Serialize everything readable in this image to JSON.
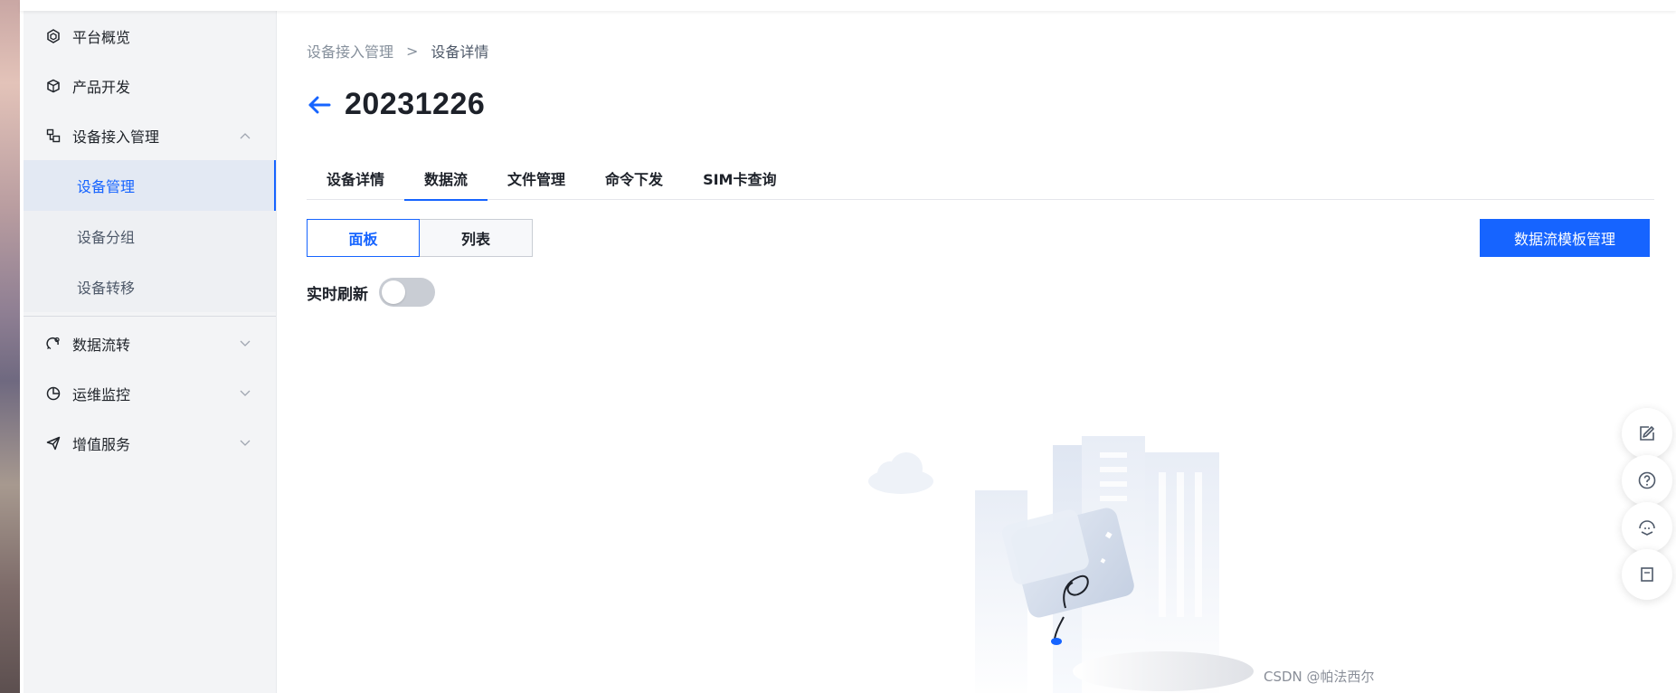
{
  "sidebar": {
    "items": [
      {
        "label": "平台概览",
        "icon": "overview-icon"
      },
      {
        "label": "产品开发",
        "icon": "cube-icon"
      },
      {
        "label": "设备接入管理",
        "icon": "device-access-icon",
        "expanded": true,
        "children": [
          {
            "label": "设备管理",
            "active": true
          },
          {
            "label": "设备分组"
          },
          {
            "label": "设备转移"
          }
        ]
      },
      {
        "label": "数据流转",
        "icon": "data-flow-icon"
      },
      {
        "label": "运维监控",
        "icon": "pie-chart-icon"
      },
      {
        "label": "增值服务",
        "icon": "send-icon"
      }
    ]
  },
  "breadcrumb": {
    "parent": "设备接入管理",
    "separator": ">",
    "current": "设备详情"
  },
  "page": {
    "title": "20231226"
  },
  "tabs": [
    {
      "label": "设备详情"
    },
    {
      "label": "数据流",
      "active": true
    },
    {
      "label": "文件管理"
    },
    {
      "label": "命令下发"
    },
    {
      "label": "SIM卡查询"
    }
  ],
  "view_toggle": {
    "panel": "面板",
    "list": "列表",
    "selected": "面板"
  },
  "actions": {
    "template_manage": "数据流模板管理"
  },
  "realtime": {
    "label": "实时刷新",
    "enabled": false
  },
  "watermark": "CSDN @帕法西尔",
  "colors": {
    "accent": "#1664ff",
    "sidebar_bg": "#f3f4f6",
    "active_sub_bg": "#e3e9f3"
  }
}
